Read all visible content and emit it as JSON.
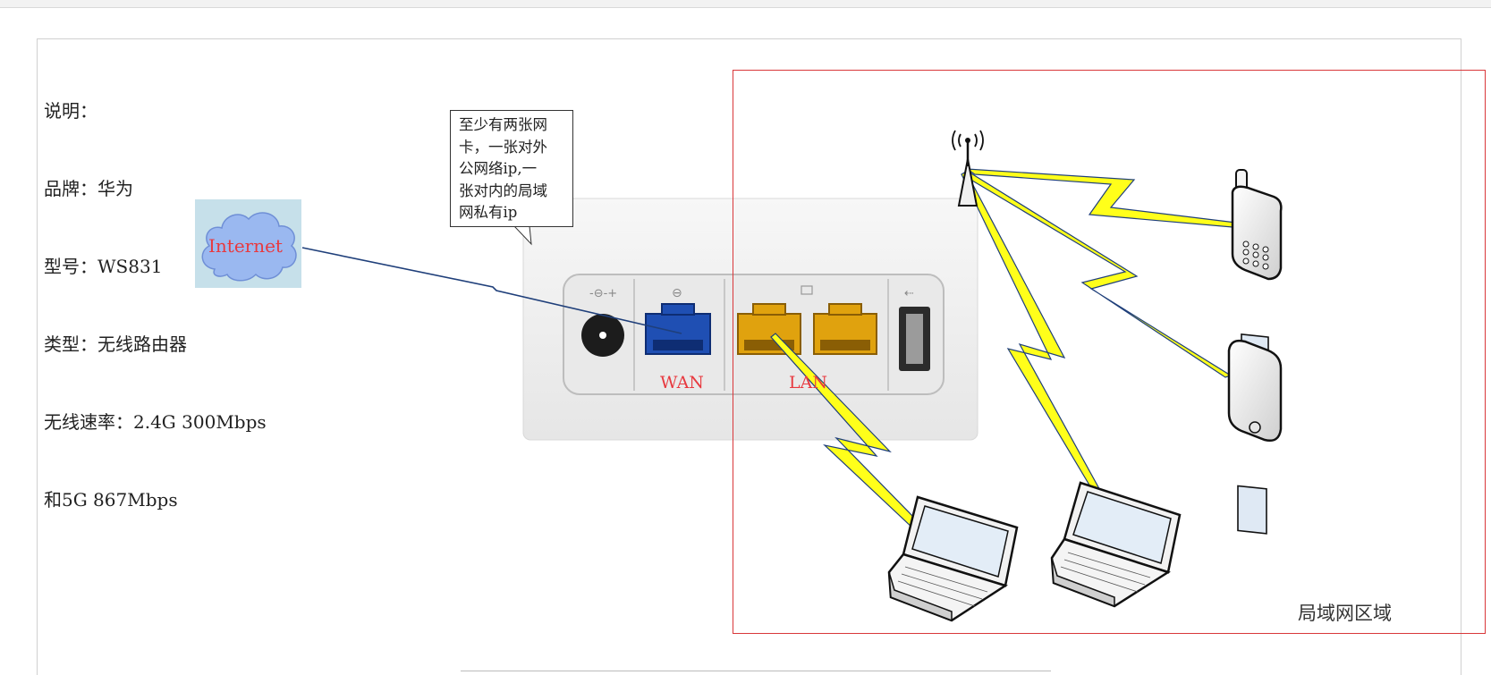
{
  "notes": {
    "line1": "说明：",
    "line2": "品牌：华为",
    "line3": "型号：WS831",
    "line4": "类型：无线路由器",
    "line5": "无线速率：2.4G 300Mbps",
    "line6": "和5G 867Mbps"
  },
  "callout": {
    "line1": "至少有两张网",
    "line2": "卡，一张对外",
    "line3": "公网络ip,一",
    "line4": "张对内的局域",
    "line5": "网私有ip"
  },
  "internet_label": "Internet",
  "router": {
    "wan_label": "WAN",
    "lan_label": "LAN"
  },
  "lan_zone_label": "局域网区域",
  "colors": {
    "zone_border": "#d9373a",
    "label_red": "#e8393f",
    "link_line": "#1f3f7a",
    "lightning": "#ffff1a",
    "wan_port": "#1f4fb3",
    "lan_port": "#e0a20e"
  }
}
